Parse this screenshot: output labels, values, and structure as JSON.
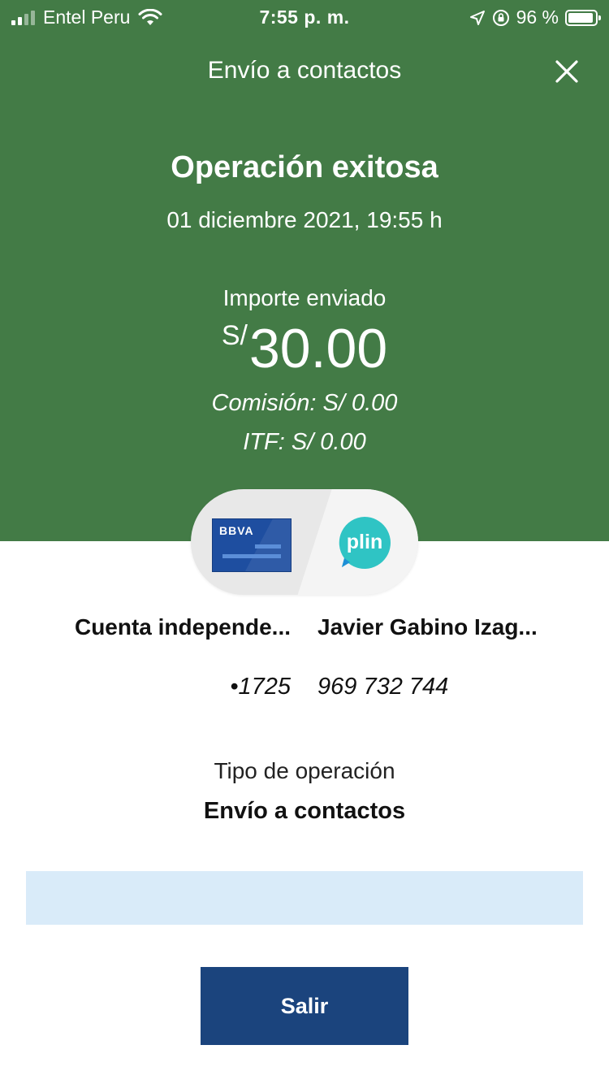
{
  "status_bar": {
    "carrier": "Entel Peru",
    "time": "7:55 p. m.",
    "battery_percent": "96 %"
  },
  "header": {
    "title": "Envío a contactos",
    "close_icon": "close-icon"
  },
  "result": {
    "headline": "Operación exitosa",
    "datetime": "01 diciembre 2021, 19:55 h",
    "amount_label": "Importe enviado",
    "currency": "S/",
    "amount": "30.00",
    "commission": "Comisión:  S/ 0.00",
    "itf": "ITF:  S/ 0.00"
  },
  "transfer": {
    "from_logo_text": "BBVA",
    "to_logo_text": "plin",
    "from_name": "Cuenta independe...",
    "to_name": "Javier Gabino Izag...",
    "from_account": "•1725",
    "to_phone": "969 732 744"
  },
  "operation": {
    "type_label": "Tipo de operación",
    "type_value": "Envío a contactos"
  },
  "footer": {
    "exit_label": "Salir"
  },
  "colors": {
    "header_green": "#437b46",
    "button_blue": "#1b447d",
    "banner_blue": "#d9ebf9",
    "plin_teal": "#2fc4c4"
  }
}
